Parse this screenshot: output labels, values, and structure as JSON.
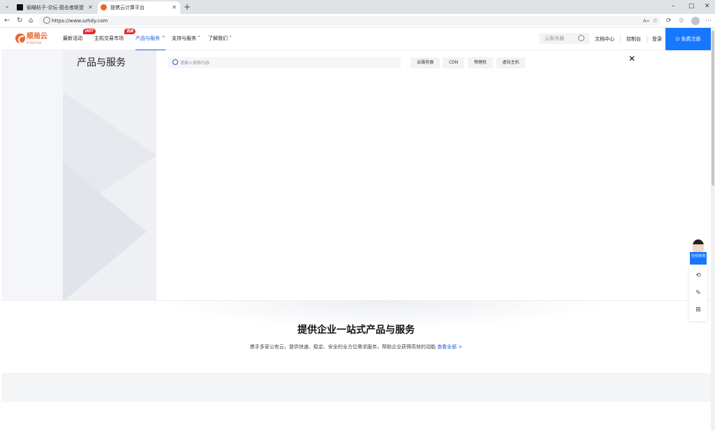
{
  "browser": {
    "tabs": [
      {
        "title": "偷瞄帖子-论坛-题击者联盟",
        "active": false
      },
      {
        "title": "提携云计算平台",
        "active": true
      }
    ],
    "new_tab": "+",
    "url": "https://www.szhdy.com",
    "controls": {
      "minimize": "–",
      "maximize": "□",
      "close": "✕"
    }
  },
  "header": {
    "logo_text": "顺局云",
    "logo_sub": "PUDIYUN",
    "nav": [
      {
        "label": "最新活动",
        "badge": "HOT"
      },
      {
        "label": "主机交易市场",
        "badge": "热卖"
      },
      {
        "label": "产品与服务 ^",
        "active": true
      },
      {
        "label": "支持与服务 ˅"
      },
      {
        "label": "了解我们 ˅"
      }
    ],
    "search_placeholder": "云服务器",
    "links": [
      "文档中心",
      "控制台",
      "登录"
    ],
    "register": "免费注册"
  },
  "mega_menu": {
    "title": "产品与服务",
    "search_placeholder": "请输入搜索内容",
    "chips": [
      "云服务器",
      "CDN",
      "物理机",
      "虚拟主机"
    ],
    "close": "✕"
  },
  "section": {
    "title": "提供企业一站式产品与服务",
    "desc": "携手多家公有云，提供快速、稳定、安全的全方位需求服务，帮助企业获得高效的动能",
    "more": "查看全部 >"
  },
  "float": {
    "consult": "在线咨询"
  },
  "colors": {
    "brand_orange": "#e9672d",
    "primary_blue": "#1677ff",
    "active_blue": "#1f5bd6",
    "hot_red": "#e8262d"
  }
}
